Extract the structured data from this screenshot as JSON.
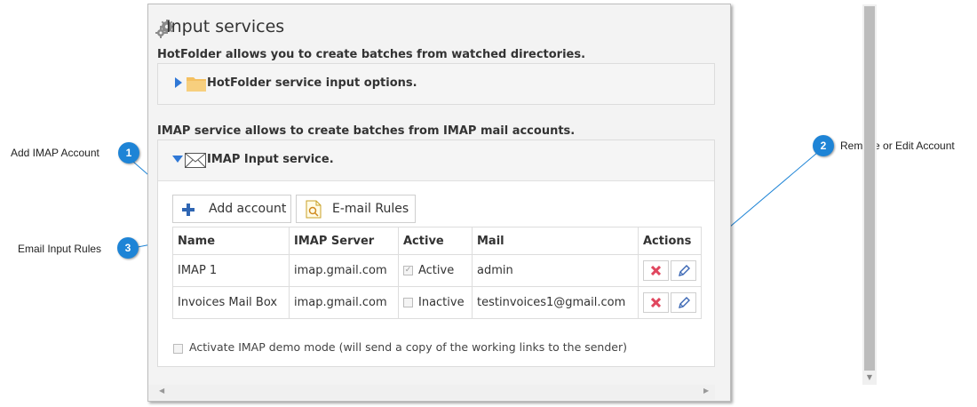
{
  "window": {
    "title": "Input services"
  },
  "hotfolder": {
    "description": "HotFolder allows you to create batches from watched directories.",
    "panel_title": "HotFolder service input options."
  },
  "imap": {
    "description": "IMAP service allows to create batches from IMAP mail accounts.",
    "panel_title": "IMAP Input service.",
    "add_account_label": "Add account",
    "email_rules_label": "E-mail Rules",
    "columns": [
      "Name",
      "IMAP Server",
      "Active",
      "Mail",
      "Actions"
    ],
    "rows": [
      {
        "name": "IMAP 1",
        "server": "imap.gmail.com",
        "active_checked": true,
        "active_label": "Active",
        "mail": "admin"
      },
      {
        "name": "Invoices Mail Box",
        "server": "imap.gmail.com",
        "active_checked": false,
        "active_label": "Inactive",
        "mail": "testinvoices1@gmail.com"
      }
    ],
    "demo_mode_label": "Activate IMAP demo mode (will send a copy of the working links to the sender)",
    "demo_mode_checked": false
  },
  "callouts": [
    {
      "number": "1",
      "label": "Add IMAP Account"
    },
    {
      "number": "2",
      "label": "Remove or Edit Account"
    },
    {
      "number": "3",
      "label": "Email Input Rules"
    }
  ],
  "colors": {
    "callout": "#1e84d6",
    "delete": "#e0475f",
    "edit": "#3b67b4",
    "folder": "#f4c061",
    "expand": "#2f78d6"
  }
}
